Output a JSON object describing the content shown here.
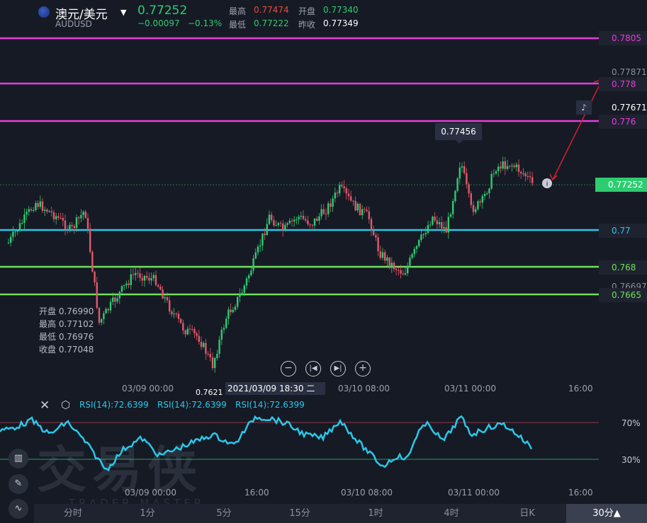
{
  "header": {
    "pair_name": "澳元/美元",
    "symbol": "AUDUSD",
    "last_price": "0.77252",
    "change": "−0.00097",
    "change_pct": "−0.13%",
    "high_label": "最高",
    "high_value": "0.77474",
    "open_label": "开盘",
    "open_value": "0.77340",
    "low_label": "最低",
    "low_value": "0.77222",
    "prevclose_label": "昨收",
    "prevclose_value": "0.77349",
    "up_color": "#2ecc71",
    "down_color": "#e74c3c"
  },
  "price_levels": [
    {
      "label": "0.7805",
      "color": "#e83cdc"
    },
    {
      "label": "0.77871",
      "color": "#8a8f9a"
    },
    {
      "label": "0.778",
      "color": "#e83cdc"
    },
    {
      "label": "0.77671",
      "color": "#ffffff"
    },
    {
      "label": "0.776",
      "color": "#e83cdc"
    },
    {
      "label": "0.77252",
      "color": "#2ecc71"
    },
    {
      "label": "0.77",
      "color": "#29c8e8"
    },
    {
      "label": "0.768",
      "color": "#6fe05a"
    },
    {
      "label": "0.76697",
      "color": "#8a8f9a"
    },
    {
      "label": "0.7665",
      "color": "#6fe05a"
    }
  ],
  "tooltip_high": "0.77456",
  "low_marker": "0.7621",
  "ohlc": {
    "open": "开盘 0.76990",
    "high": "最高 0.77102",
    "low": "最低 0.76976",
    "close": "收盘 0.77048"
  },
  "crosshair_time": "2021/03/09 18:30 二",
  "x_labels": [
    "03/09 00:00",
    "03/10 08:00",
    "03/11 00:00",
    "16:00"
  ],
  "rsi_x_labels": [
    "03/09 00:00",
    "16:00",
    "03/10 08:00",
    "03/11 00:00",
    "16:00"
  ],
  "rsi": {
    "label1": "RSI(14):72.6399",
    "label2": "RSI(14):72.6399",
    "label3": "RSI(14):72.6399",
    "level_high": "70%",
    "level_low": "30%",
    "color": "#29c8e8"
  },
  "watermark": "交易侠",
  "watermark_sub": "TRADER MASTER",
  "timeframes": [
    "分时",
    "1分",
    "5分",
    "15分",
    "1时",
    "4时",
    "日K"
  ],
  "selected_timeframe": "30分▲",
  "icons": {
    "close": "close-icon",
    "settings": "settings-icon",
    "zoom_out": "zoom-out-icon",
    "prev": "step-back-icon",
    "next": "step-forward-icon",
    "zoom_in": "zoom-in-icon",
    "alert": "bell-icon",
    "info": "info-icon"
  }
}
